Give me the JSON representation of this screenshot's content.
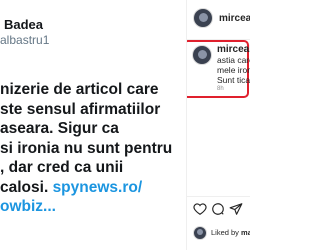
{
  "tweet": {
    "author_name": "Badea",
    "author_handle": "albastru1",
    "lines": [
      "nizerie de articol care",
      "ste sensul afirmatiilor",
      "aseara. Sigur ca",
      "si ironia nu sunt pentru",
      ", dar cred ca unii",
      "calosi. "
    ],
    "link_part": "spynews.ro/",
    "last_line": "owbiz..."
  },
  "instagram": {
    "post_username": "mirceabad",
    "comment": {
      "username": "mirceabad",
      "lines": [
        "astia care",
        "mele ironi",
        "Sunt ticalo"
      ],
      "time": "8h"
    },
    "liked_by_prefix": "Liked by ",
    "liked_by_user": "mari"
  },
  "colors": {
    "highlight": "#e0202d",
    "link": "#1b95e0"
  }
}
